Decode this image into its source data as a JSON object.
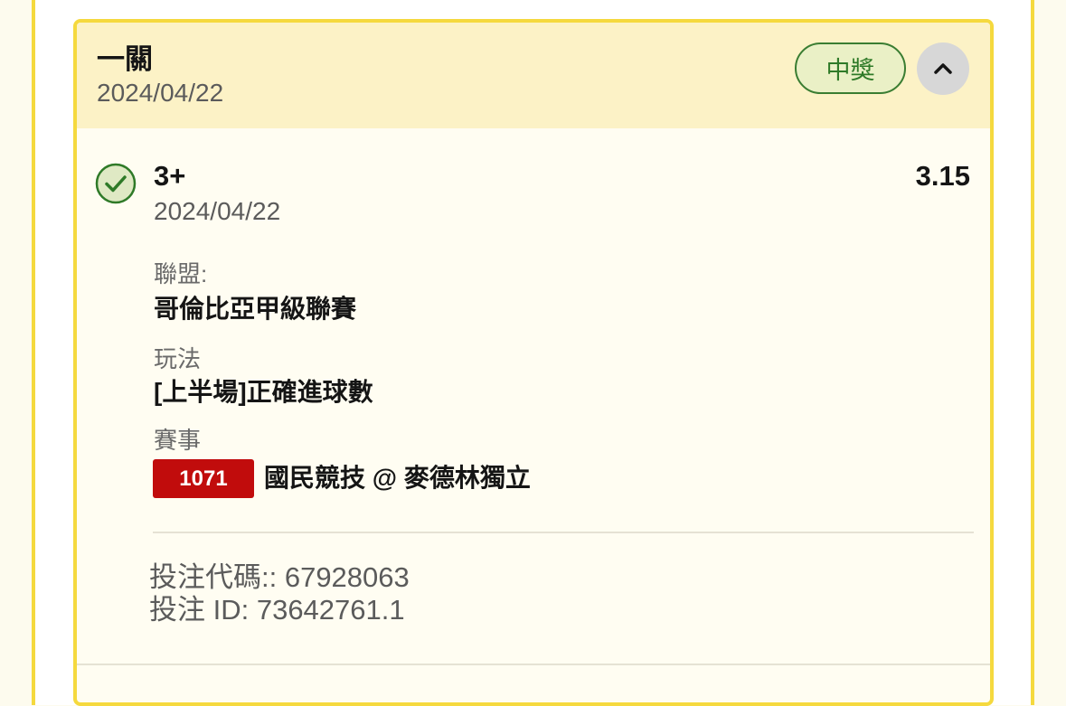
{
  "bet": {
    "type": "一關",
    "date": "2024/04/22",
    "status_badge": "中獎",
    "collapse_icon": "chevron-up-icon"
  },
  "selection": {
    "status_icon": "check-circle-icon",
    "name": "3+",
    "date": "2024/04/22",
    "odds": "3.15",
    "league_label": "聯盟:",
    "league_value": "哥倫比亞甲級聯賽",
    "market_label": "玩法",
    "market_value": "[上半場]正確進球數",
    "event_label": "賽事",
    "match_id": "1071",
    "match_teams": "國民競技 @ 麥德林獨立"
  },
  "ticket": {
    "code_line": "投注代碼:: 67928063",
    "id_line": "投注 ID: 73642761.1"
  },
  "colors": {
    "card_border": "#f5d93e",
    "header_bg": "#fcf2c6",
    "win_green": "#2f7a28",
    "match_badge_red": "#c10c0c"
  }
}
